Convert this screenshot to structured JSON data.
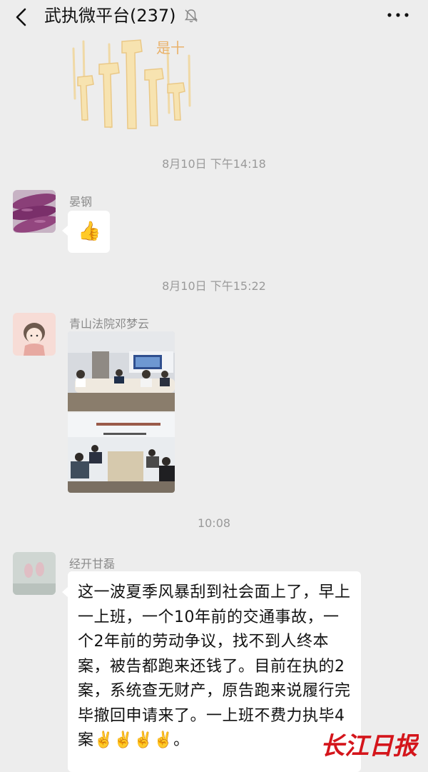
{
  "header": {
    "title": "武执微平台(237)",
    "back_icon": "chevron-left-icon",
    "mute_icon": "bell-muted-icon",
    "more_icon": "more-dots-icon"
  },
  "sticker": {
    "caption": "是十"
  },
  "timestamps": [
    "8月10日 下午14:18",
    "8月10日 下午15:22",
    "10:08"
  ],
  "messages": [
    {
      "sender": "晏钢",
      "type": "emoji",
      "content": "👍"
    },
    {
      "sender": "青山法院邓梦云",
      "type": "image"
    },
    {
      "sender": "经开甘磊",
      "type": "text",
      "text": "这一波夏季风暴刮到社会面上了，早上一上班，一个10年前的交通事故，一个2年前的劳动争议，找不到人终本案，被告都跑来还钱了。目前在执的2案，系统查无财产，原告跑来说履行完毕撤回申请来了。一上班不费力执毕4案",
      "emojis": "✌️✌️✌️✌️",
      "tail": "。"
    }
  ],
  "watermark": "长江日报",
  "colors": {
    "background": "#ededed",
    "bubble": "#ffffff",
    "meta_text": "#9a9a9a"
  }
}
